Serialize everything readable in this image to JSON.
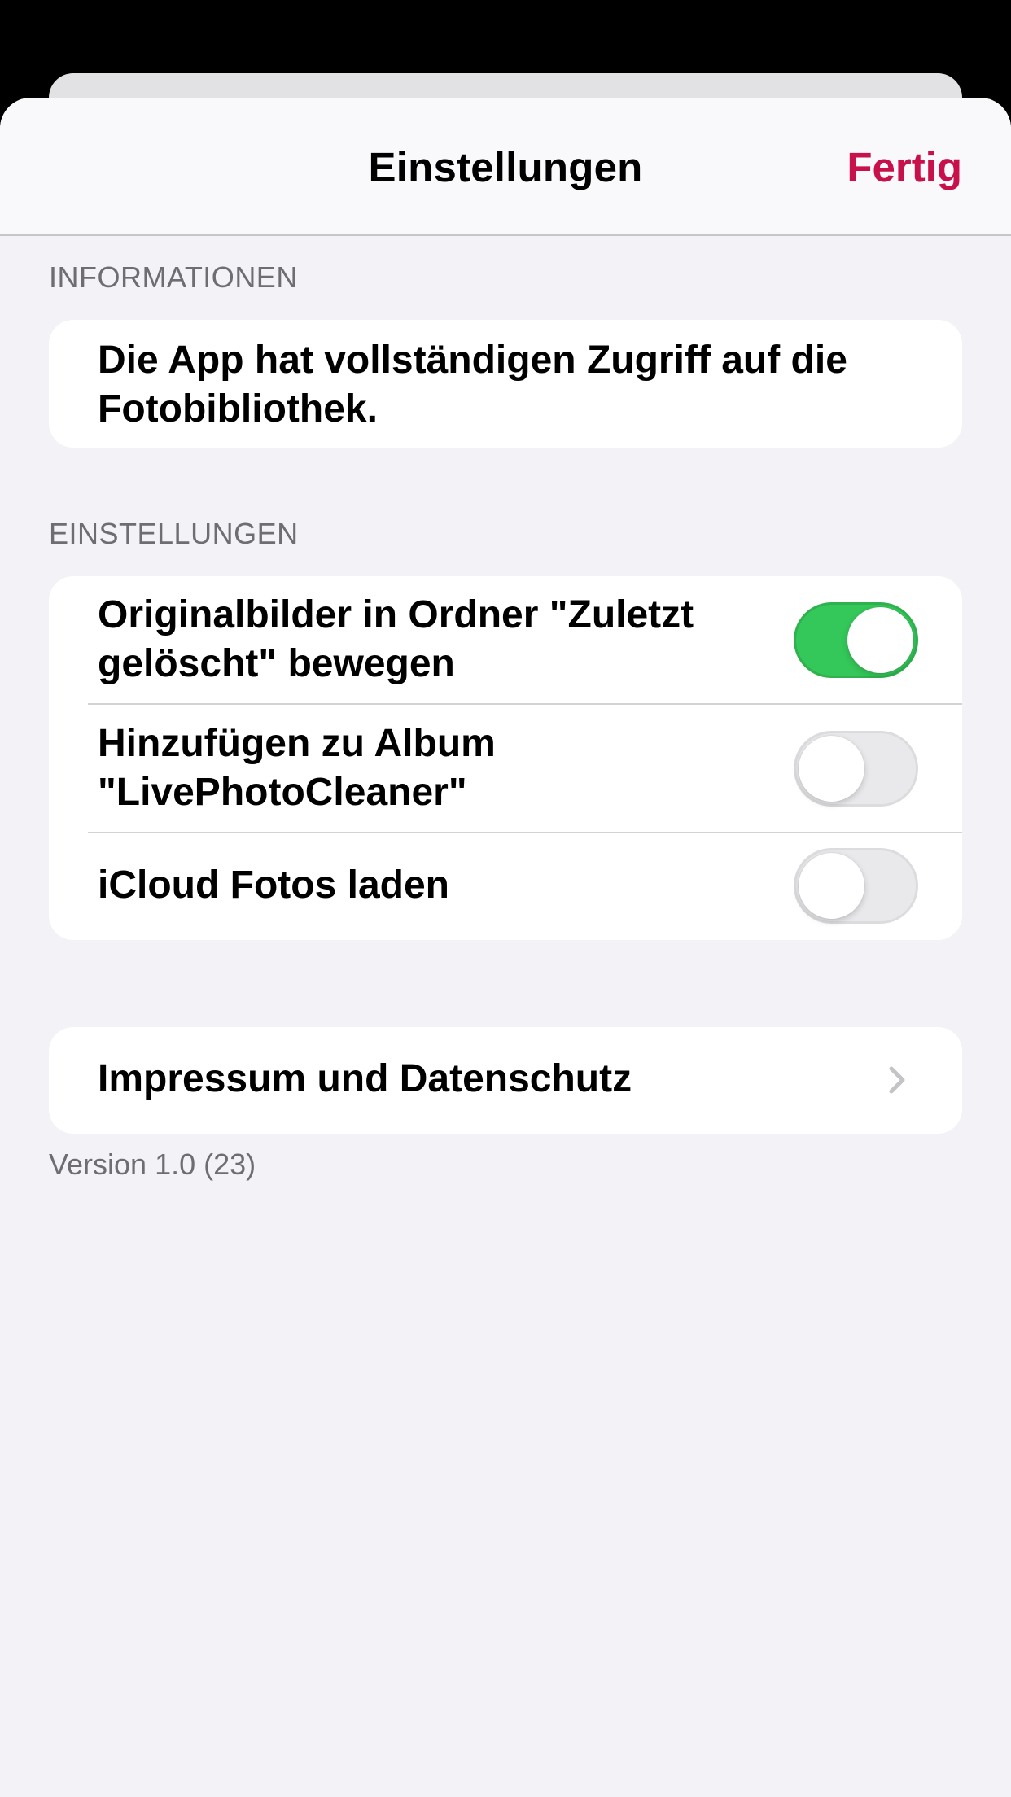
{
  "nav": {
    "title": "Einstellungen",
    "done_label": "Fertig",
    "accent_color": "#c8104a"
  },
  "info_section": {
    "header": "INFORMATIONEN",
    "text": "Die App hat vollständigen Zugriff auf die Fotobibliothek."
  },
  "settings_section": {
    "header": "EINSTELLUNGEN",
    "rows": [
      {
        "label": "Originalbilder in Ordner \"Zuletzt gelöscht\" bewegen",
        "enabled": true
      },
      {
        "label": "Hinzufügen zu Album \"LivePhotoCleaner\"",
        "enabled": false
      },
      {
        "label": "iCloud Fotos laden",
        "enabled": false
      }
    ],
    "toggle_on_color": "#34c759"
  },
  "legal": {
    "label": "Impressum und Datenschutz",
    "icon": "chevron-right-icon"
  },
  "footer": {
    "version": "Version 1.0 (23)"
  }
}
